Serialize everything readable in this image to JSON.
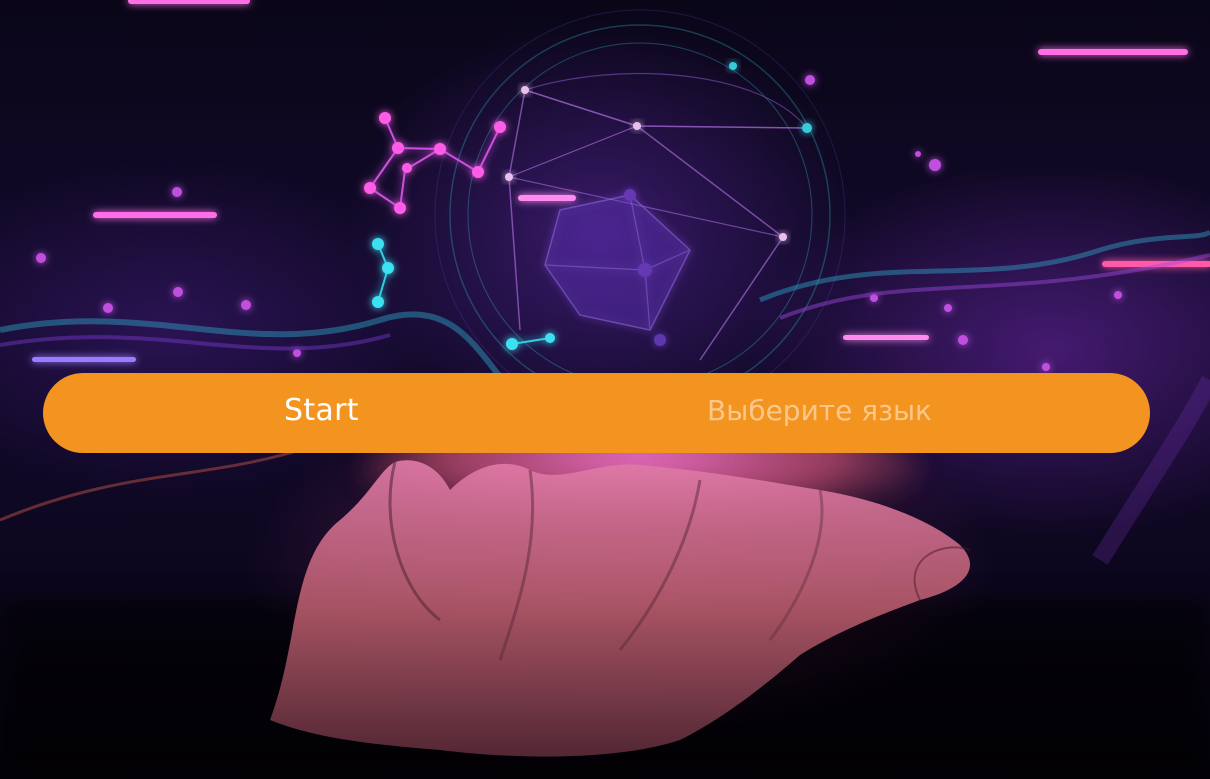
{
  "menu": {
    "start_label": "Start",
    "language_label": "Выберите язык"
  },
  "colors": {
    "menu_bar": "#f39420",
    "start_text": "#ffffff",
    "language_text": "#fcc88a",
    "neon_pink": "#ff4fd8",
    "neon_cyan": "#3ee0f0"
  },
  "background": {
    "icons": [
      "network-globe-icon",
      "cube-network-icon",
      "open-hand-image"
    ]
  }
}
